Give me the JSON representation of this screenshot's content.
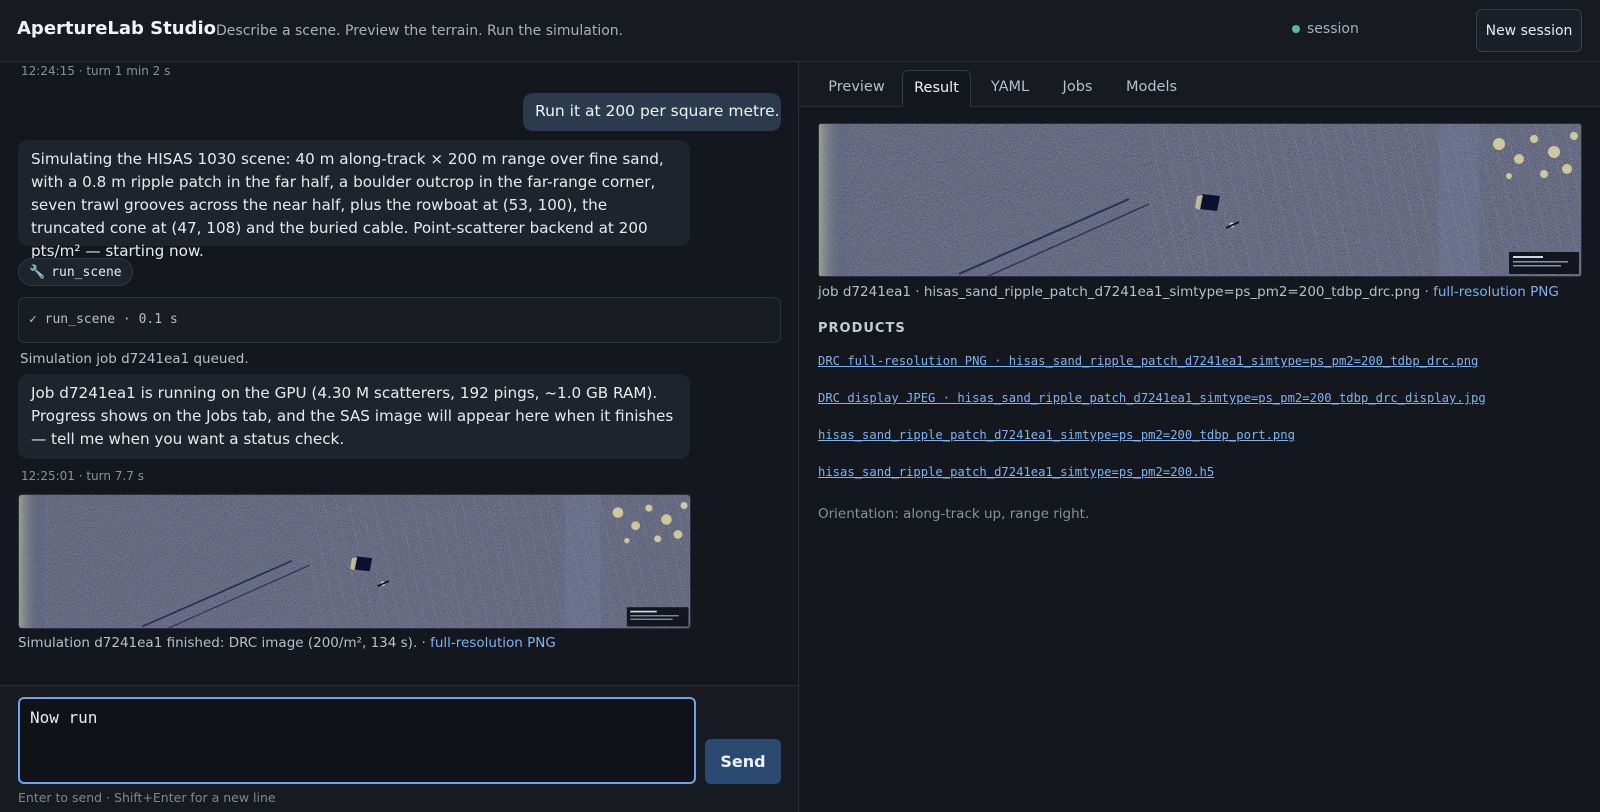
{
  "header": {
    "title": "ApertureLab Studio",
    "tagline": "Describe a scene. Preview the terrain. Run the simulation.",
    "session_label": "session",
    "new_session_label": "New session"
  },
  "chat": {
    "meta_top": "12:24:15 · turn 1 min 2 s",
    "user_message": "Run it at 200 per square metre.",
    "assistant_message_1": "Simulating the HISAS 1030 scene: 40 m along-track × 200 m range over fine sand, with a 0.8 m ripple patch in the far half, a boulder outcrop in the far-range corner, seven trawl grooves across the near half, plus the rowboat at (53, 100), the truncated cone at (47, 108) and the buried cable. Point-scatterer backend at 200 pts/m² — starting now.",
    "tool_chip_icon": "wrench-icon",
    "tool_chip_label": "run_scene",
    "tool_result": "✓ run_scene · 0.1 s",
    "job_queued": "Simulation job d7241ea1 queued.",
    "assistant_message_2": "Job d7241ea1 is running on the GPU (4.30 M scatterers, 192 pings, ~1.0 GB RAM). Progress shows on the Jobs tab, and the SAS image will appear here when it finishes — tell me when you want a status check.",
    "meta_bottom": "12:25:01 · turn 7.7 s",
    "finished_text": "Simulation d7241ea1 finished: DRC image (200/m², 134 s). · ",
    "finished_link": "full-resolution PNG"
  },
  "composer": {
    "value": "Now run ",
    "send_label": "Send",
    "hint": "Enter to send · Shift+Enter for a new line"
  },
  "tabs": [
    {
      "label": "Preview"
    },
    {
      "label": "Result"
    },
    {
      "label": "YAML"
    },
    {
      "label": "Jobs"
    },
    {
      "label": "Models"
    }
  ],
  "result": {
    "caption_text": "job d7241ea1 · hisas_sand_ripple_patch_d7241ea1_simtype=ps_pm2=200_tdbp_drc.png · ",
    "caption_link": "full-resolution PNG",
    "products_heading": "PRODUCTS",
    "products": [
      "DRC full-resolution PNG · hisas_sand_ripple_patch_d7241ea1_simtype=ps_pm2=200_tdbp_drc.png",
      "DRC display JPEG · hisas_sand_ripple_patch_d7241ea1_simtype=ps_pm2=200_tdbp_drc_display.jpg",
      "hisas_sand_ripple_patch_d7241ea1_simtype=ps_pm2=200_tdbp_port.png",
      "hisas_sand_ripple_patch_d7241ea1_simtype=ps_pm2=200.h5"
    ],
    "orientation": "Orientation: along-track up, range right."
  },
  "colors": {
    "accent": "#6aa6e8",
    "link": "#7fb2f0",
    "session_dot": "#4cc38a",
    "send_bg": "#2b4a72"
  }
}
